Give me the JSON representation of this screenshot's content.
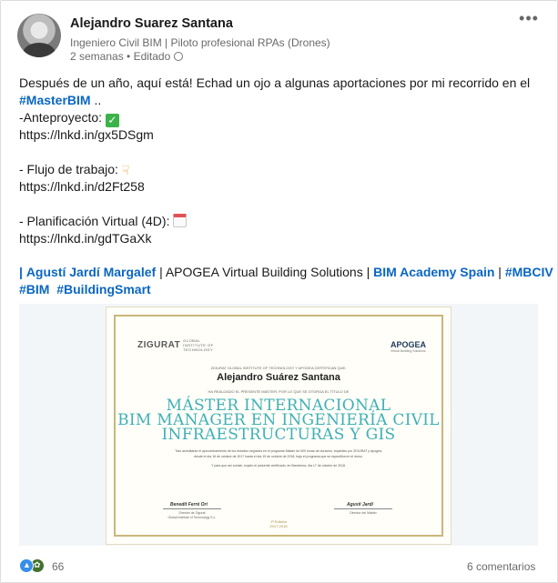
{
  "post": {
    "author": "Alejandro Suarez Santana",
    "headline": "Ingeniero Civil BIM | Piloto profesional RPAs (Drones)",
    "meta": "2 semanas • Editado",
    "menu": "•••",
    "intro": "Después de un año, aquí está! Echad un ojo a algunas aportaciones por mi recorrido en el",
    "hashtag_masterbim": "#MasterBIM",
    "ellipsis": " ..",
    "item1_label": "-Anteproyecto: ",
    "item1_link": "https://lnkd.in/gx5DSgm",
    "item2_label": "- Flujo de trabajo: ",
    "item2_link": "https://lnkd.in/d2Ft258",
    "item3_label": "- Planificación Virtual (4D): ",
    "item3_link": "https://lnkd.in/gdTGaXk",
    "mentions": {
      "lead_bar": "|",
      "agusti": "Agustí Jardí Margalef",
      "apogea": " | APOGEA Virtual Building Solutions | ",
      "bim_academy": "BIM Academy Spain",
      "bar2": " | ",
      "mbciv": "#MBCIV",
      "bim": "#BIM",
      "buildingsmart": "#BuildingSmart"
    }
  },
  "certificate": {
    "zigurat": "ZIGURAT",
    "zigurat_sub": "GLOBAL INSTITUTE OF TECHNOLOGY",
    "apogea": "APOGEA",
    "apogea_sub": "Virtual Building Solutions",
    "certify": "ZIGURAT GLOBAL INSTITUTE OF TECHNOLOGY Y APOGEA CERTIFICAN QUE:",
    "name": "Alejandro Suárez Santana",
    "awarded": "HA REALIZADO EL PRESENTE MÁSTER, POR LO QUE SE OTORGA EL TÍTULO DE",
    "title_line1": "MÁSTER INTERNACIONAL",
    "title_line2": "BIM MANAGER EN INGENIERÍA CIVIL",
    "title_line3": "INFRAESTRUCTURAS Y GIS",
    "fine1": "Tras acreditarse el aprovechamiento de los estudios seguidos en el programa Máster de 600 horas de duración, impartido por ZIGURAT y Apogea,",
    "fine2": "desde el día 16 de octubre de 2017 hasta el día 19 de octubre de 2018, bajo el programa que se especifica en el dorso.",
    "fine3": "Y para que así conste, expido el presente certificado, en Barcelona, día 17 de octubre de 2018.",
    "sig1_name": "Benedit Ferré Orí",
    "sig1_role": "Director de Zigurat",
    "sig1_org": "Global Institute of Technology S.L.",
    "sig2_name": "Agustí Jardí",
    "sig2_role": "Director del Máster",
    "edition": "1ª Edición",
    "years": "2017-2018"
  },
  "social": {
    "reaction_count": "66",
    "comments": "6 comentarios"
  },
  "colors": {
    "link": "#0a66c2",
    "like": "#378fe9",
    "celebrate": "#44712e",
    "cert_title": "#3fb0b7",
    "cert_frame": "#c9b77a"
  },
  "icons": {
    "emoji1": "check-mark-emoji",
    "emoji2": "pointing-down-hand-emoji",
    "emoji3": "calendar-emoji"
  }
}
